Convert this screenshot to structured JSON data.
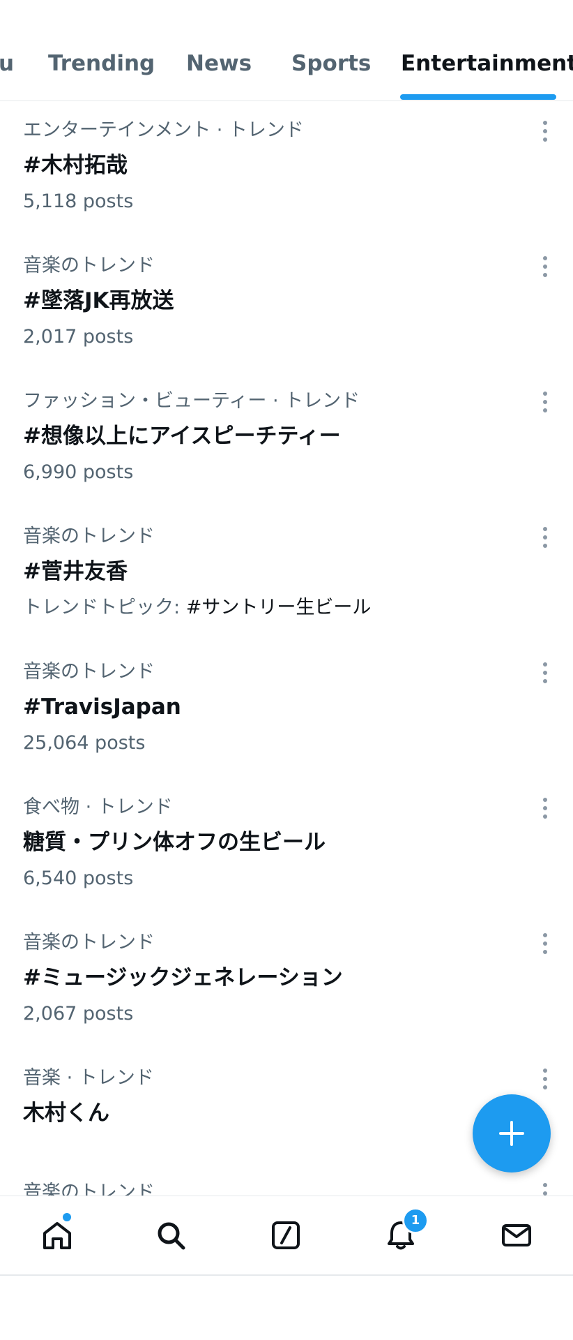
{
  "tabs": {
    "partial": "u",
    "trending": "Trending",
    "news": "News",
    "sports": "Sports",
    "entertainment": "Entertainment"
  },
  "trends": [
    {
      "meta": "エンターテインメント · トレンド",
      "name": "#木村拓哉",
      "count": "5,118 posts"
    },
    {
      "meta": "音楽のトレンド",
      "name": "#墜落JK再放送",
      "count": "2,017 posts"
    },
    {
      "meta": "ファッション・ビューティー · トレンド",
      "name": "#想像以上にアイスピーチティー",
      "count": "6,990 posts"
    },
    {
      "meta": "音楽のトレンド",
      "name": "#菅井友香",
      "topic_label": "トレンドトピック:",
      "topic_value": "#サントリー生ビール"
    },
    {
      "meta": "音楽のトレンド",
      "name": "#TravisJapan",
      "count": "25,064 posts"
    },
    {
      "meta": "食べ物 · トレンド",
      "name": "糖質・プリン体オフの生ビール",
      "count": "6,540 posts"
    },
    {
      "meta": "音楽のトレンド",
      "name": "#ミュージックジェネレーション",
      "count": "2,067 posts"
    },
    {
      "meta": "音楽 · トレンド",
      "name": "木村くん"
    },
    {
      "meta": "音楽のトレンド"
    }
  ],
  "fab": {
    "icon": "plus-icon"
  },
  "bottom_nav": {
    "items": [
      "home-icon",
      "search-icon",
      "grok-icon",
      "bell-icon",
      "mail-icon"
    ],
    "notification_count": "1",
    "accent": "#1d9bf0"
  }
}
